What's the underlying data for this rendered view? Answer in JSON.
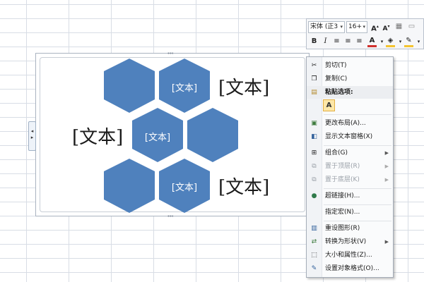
{
  "colors": {
    "hex_fill": "#4f81bd",
    "accent_red": "#d0312d",
    "highlight_yellow": "#f4c430"
  },
  "smartart": {
    "hex_labels": [
      "[文本]",
      "[文本]",
      "[文本]"
    ],
    "side_labels": [
      "[文本]",
      "[文本]",
      "[文本]"
    ]
  },
  "mini_toolbar": {
    "font_name": "宋体 (正3",
    "font_size": "16+",
    "buttons_row1": [
      "grow-font-icon",
      "shrink-font-icon",
      "format-painter-icon",
      "clear-format-icon"
    ],
    "bold": "B",
    "italic": "I"
  },
  "context_menu": {
    "items": [
      {
        "label": "剪切(T)",
        "icon": "cut-icon"
      },
      {
        "label": "复制(C)",
        "icon": "copy-icon"
      },
      {
        "label": "粘贴选项:",
        "icon": "paste-icon"
      },
      {
        "label": "A",
        "icon": "paste-keep-text-icon"
      },
      {
        "label": "更改布局(A)...",
        "icon": "change-layout-icon"
      },
      {
        "label": "显示文本窗格(X)",
        "icon": "text-pane-icon"
      },
      {
        "label": "组合(G)",
        "icon": "group-icon"
      },
      {
        "label": "置于顶层(R)",
        "icon": "bring-to-front-icon"
      },
      {
        "label": "置于底层(K)",
        "icon": "send-to-back-icon"
      },
      {
        "label": "超链接(H)...",
        "icon": "hyperlink-icon"
      },
      {
        "label": "指定宏(N)...",
        "icon": "macro-icon"
      },
      {
        "label": "重设图形(R)",
        "icon": "reset-graphic-icon"
      },
      {
        "label": "转换为形状(V)",
        "icon": "convert-shapes-icon"
      },
      {
        "label": "大小和属性(Z)...",
        "icon": "size-properties-icon"
      },
      {
        "label": "设置对象格式(O)...",
        "icon": "format-object-icon"
      }
    ]
  }
}
